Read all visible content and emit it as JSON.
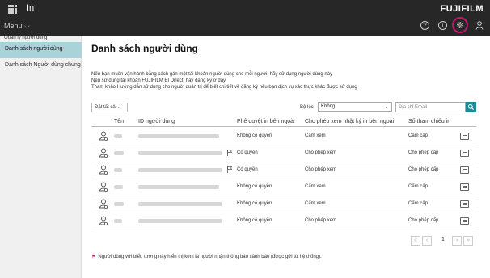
{
  "app": {
    "title": "In",
    "brand": "FUJIFILM",
    "menu_label": "Menu"
  },
  "toolbar": {
    "help_icon": "?",
    "info_icon": "i",
    "settings_icon": "gear-icon",
    "user_icon": "user-icon"
  },
  "sidebar": {
    "section_header": "Quản lý người dùng",
    "items": [
      {
        "label": "Danh sách người dùng"
      },
      {
        "label": "Danh sách Người dùng chung"
      }
    ]
  },
  "main": {
    "title": "Danh sách người dùng",
    "description": [
      "Nếu bạn muốn vận hành bằng cách gán một tài khoản người dùng cho mỗi người, hãy sử dụng người dùng này",
      "Nếu sử dụng tài khoản FUJIFILM BI Direct, hãy đăng ký ở đây",
      "Tham khảo Hướng dẫn sử dụng cho người quản trị để biết chi tiết về đăng ký nếu bạn dịch vụ xác thực khác được sử dụng"
    ],
    "sort_button": "Đặt tất cả",
    "filter": {
      "label": "Bộ lọc",
      "value": "Không"
    },
    "search": {
      "placeholder": "Địa chỉ Email"
    },
    "columns": {
      "name": "Tên",
      "user_id": "ID người dùng",
      "approval": "Phê duyệt in bên ngoài",
      "log_permission": "Cho phép xem nhật ký in bên ngoài",
      "references": "Số tham chiếu in"
    },
    "rows": [
      {
        "approval": "Không có quyền",
        "log": "Cấm xem",
        "refs": "Cấm cấp"
      },
      {
        "approval": "Có quyền",
        "log": "Cho phép xem",
        "refs": "Cho phép cấp"
      },
      {
        "approval": "Có quyền",
        "log": "Cho phép xem",
        "refs": "Cho phép cấp"
      },
      {
        "approval": "Không có quyền",
        "log": "Cấm xem",
        "refs": "Cấm cấp"
      },
      {
        "approval": "Không có quyền",
        "log": "Cấm xem",
        "refs": "Cấm cấp"
      },
      {
        "approval": "Không có quyền",
        "log": "Cho phép xem",
        "refs": "Cho phép cấp"
      }
    ],
    "pagination": {
      "current_page": "1"
    },
    "footnote": "Người dùng với biểu tượng này hiển thị kèm là người nhận thông báo cảnh báo (được gửi từ hệ thống)."
  },
  "colors": {
    "topbar": "#272727",
    "accent": "#1e8a93",
    "sidebar_active": "#a9d2d9",
    "highlight_ring": "#c0186a"
  }
}
